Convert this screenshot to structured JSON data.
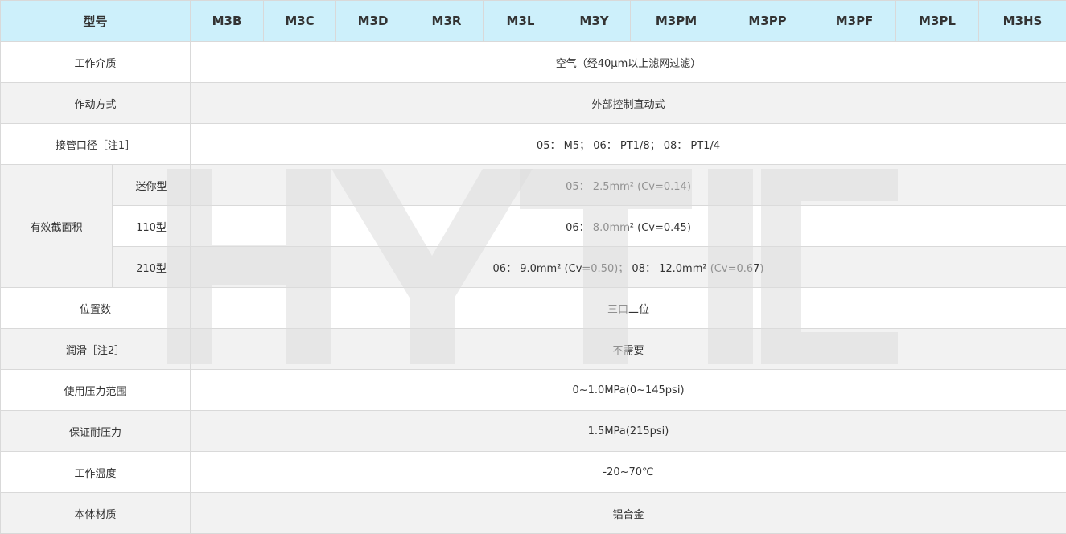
{
  "header": {
    "label": "型号",
    "models": [
      "M3B",
      "M3C",
      "M3D",
      "M3R",
      "M3L",
      "M3Y",
      "M3PM",
      "M3PP",
      "M3PF",
      "M3PL",
      "M3HS"
    ]
  },
  "rows": {
    "medium": {
      "label": "工作介质",
      "value": "空气（经40μm以上滤网过滤）"
    },
    "actuation": {
      "label": "作动方式",
      "value": "外部控制直动式"
    },
    "port": {
      "label": "接管口径［注1］",
      "value": "05： M5； 06： PT1/8； 08： PT1/4"
    },
    "effective_area": {
      "label": "有效截面积",
      "subs": [
        {
          "label": "迷你型",
          "value": "05： 2.5mm² (Cv=0.14)"
        },
        {
          "label": "110型",
          "value": "06： 8.0mm² (Cv=0.45)"
        },
        {
          "label": "210型",
          "value": "06： 9.0mm² (Cv=0.50)； 08： 12.0mm² (Cv=0.67)"
        }
      ]
    },
    "positions": {
      "label": "位置数",
      "value": "三口二位"
    },
    "lubrication": {
      "label": "润滑［注2］",
      "value": "不需要"
    },
    "pressure_range": {
      "label": "使用压力范围",
      "value": "0~1.0MPa(0~145psi)"
    },
    "proof_pressure": {
      "label": "保证耐压力",
      "value": "1.5MPa(215psi)"
    },
    "temperature": {
      "label": "工作温度",
      "value": "-20~70℃"
    },
    "body_material": {
      "label": "本体材质",
      "value": "铝合金"
    }
  },
  "watermark": {
    "text": "HYTIC",
    "color": "#e6e6e6"
  },
  "colors": {
    "header_bg": "#cdf0fb",
    "alt_row_bg": "#f2f2f2",
    "border": "#d9d9d9",
    "text": "#333333"
  }
}
